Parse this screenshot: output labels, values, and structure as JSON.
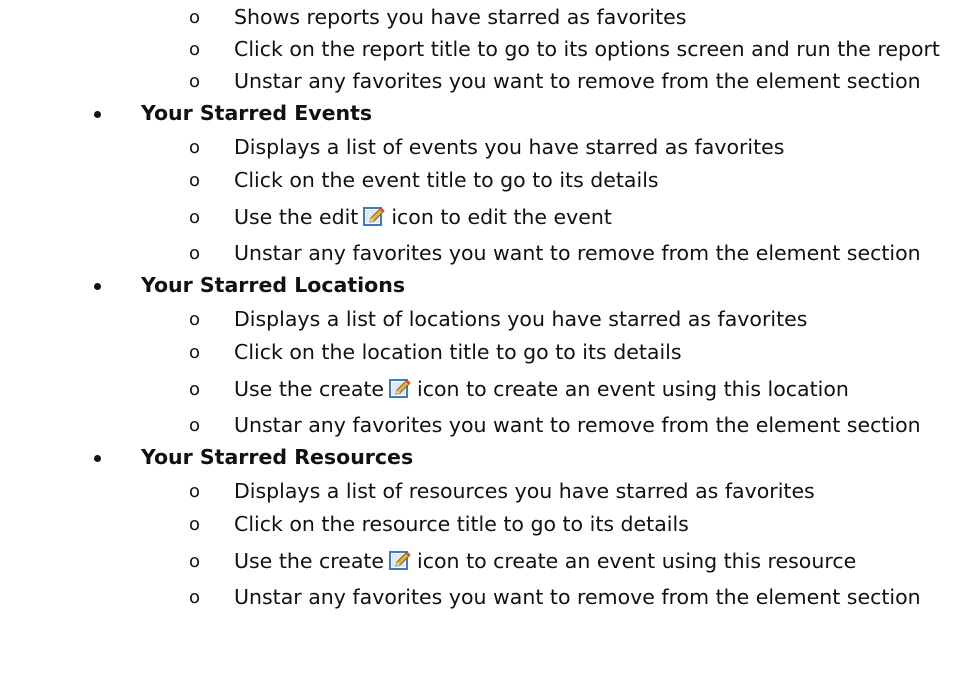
{
  "sections": [
    {
      "title": "",
      "items": [
        {
          "text": "Shows reports you have starred as favorites"
        },
        {
          "text": "Click on the report title to go to its options screen and run the report"
        },
        {
          "text": "Unstar any favorites you want to remove from the element section"
        }
      ]
    },
    {
      "title": "Your Starred Events",
      "items": [
        {
          "text": "Displays a list of events you have starred as favorites"
        },
        {
          "text": "Click on the event title to go to its details"
        },
        {
          "before": "Use the edit",
          "icon": "edit-icon",
          "after": "icon to edit the event"
        },
        {
          "text": "Unstar any favorites you want to remove from the element section"
        }
      ]
    },
    {
      "title": "Your Starred Locations",
      "items": [
        {
          "text": "Displays a list of locations you have starred as favorites"
        },
        {
          "text": "Click on the location title to go to its details"
        },
        {
          "before": "Use the create",
          "icon": "edit-icon",
          "after": "icon to create an event using this location"
        },
        {
          "text": "Unstar any favorites you want to remove from the element section"
        }
      ]
    },
    {
      "title": "Your Starred Resources",
      "items": [
        {
          "text": "Displays a list of resources you have starred as favorites"
        },
        {
          "text": "Click on the resource title to go to its details"
        },
        {
          "before": "Use the create",
          "icon": "edit-icon",
          "after": "icon to create an event using this resource"
        },
        {
          "text": "Unstar any favorites you want to remove from the element section"
        }
      ]
    }
  ],
  "sub_marker": "o"
}
